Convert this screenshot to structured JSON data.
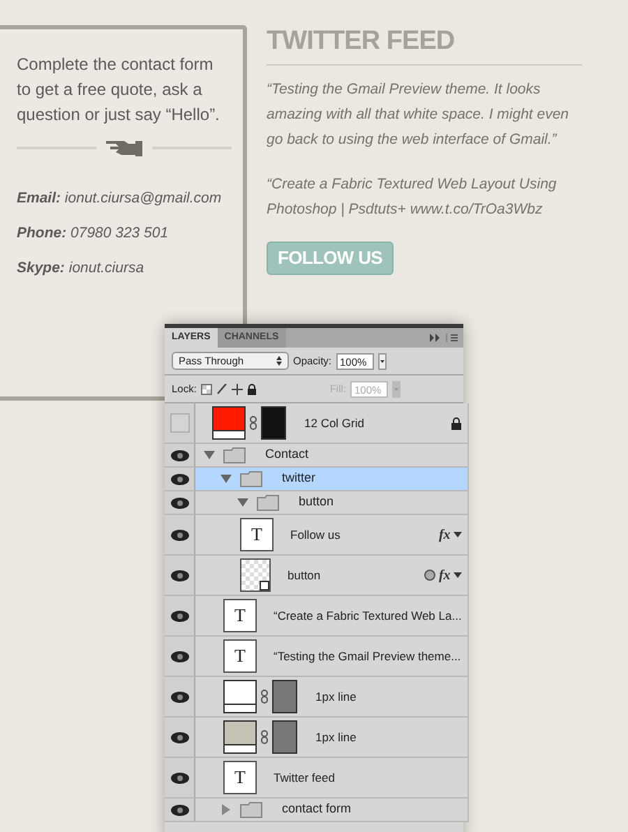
{
  "contact_card": {
    "intro": "Complete the contact form to get a free quote, ask a question or just say “Hello”.",
    "details": [
      "**Email:** ionut.ciursa@gmail.com",
      "**Phone:** 07980 323 501",
      "**Skype:** ionut.ciursa"
    ]
  },
  "twitter": {
    "title": "TWITTER FEED",
    "tweets": [
      "“Testing the Gmail Preview theme. It looks amazing with all that white space. I might even go back to using the web interface of Gmail.”",
      "“Create a Fabric Textured Web Layout Using Photoshop | Psdtuts+ www.t.co/TrOa3Wbz"
    ],
    "button": "FOLLOW US"
  },
  "layers_panel": {
    "tabs": [
      {
        "label": "LAYERS",
        "selected": true
      },
      {
        "label": "CHANNELS",
        "selected": false
      }
    ],
    "blend_mode": "Pass Through",
    "opacity_label": "Opacity:",
    "opacity": "100%",
    "lock_label": "Lock:",
    "fill_label": "Fill:",
    "fill": "100%",
    "fill_disabled": true,
    "layers": [
      {
        "kind": "fill",
        "name": "12 Col Grid",
        "visible": false,
        "selected": false,
        "locked": true,
        "color": "#ff1a00"
      },
      {
        "kind": "group",
        "name": "Contact",
        "visible": true,
        "selected": false,
        "expanded": true,
        "children": [
          {
            "kind": "group",
            "name": "twitter",
            "visible": true,
            "selected": true,
            "expanded": true,
            "children": [
              {
                "kind": "group",
                "name": "button",
                "visible": true,
                "selected": false,
                "expanded": true,
                "children": [
                  {
                    "kind": "text",
                    "name": "Follow us",
                    "thumb": "T",
                    "visible": true,
                    "selected": false,
                    "effects": "fx"
                  },
                  {
                    "kind": "smart",
                    "name": "button",
                    "visible": true,
                    "selected": false,
                    "effects": "fx"
                  }
                ]
              },
              {
                "kind": "text",
                "name": "“Create a Fabric Textured Web La...",
                "thumb": "T",
                "visible": true,
                "selected": false
              },
              {
                "kind": "text",
                "name": "“Testing the Gmail Preview theme...",
                "thumb": "T",
                "visible": true,
                "selected": false
              },
              {
                "kind": "fill",
                "name": "1px line",
                "visible": true,
                "selected": false,
                "color": "#ffffff"
              },
              {
                "kind": "fill",
                "name": "1px line",
                "visible": true,
                "selected": false,
                "color": "#c4c2b4"
              },
              {
                "kind": "text",
                "name": "Twitter feed",
                "thumb": "T",
                "visible": true,
                "selected": false
              }
            ]
          },
          {
            "kind": "group",
            "name": "contact form",
            "visible": true,
            "selected": false,
            "expanded": false
          }
        ]
      }
    ]
  }
}
